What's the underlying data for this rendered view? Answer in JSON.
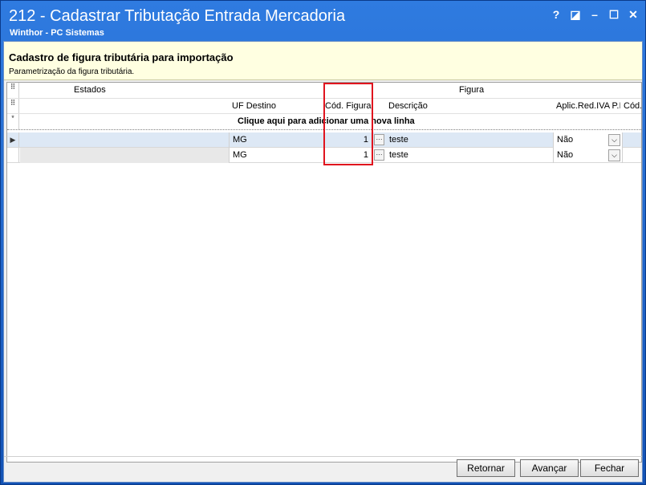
{
  "window": {
    "title": "212 - Cadastrar Tributação Entrada Mercadoria",
    "subtitle": "Winthor - PC Sistemas",
    "help": "?",
    "restore": "◪",
    "minimize": "–",
    "maximize": "☐",
    "close": "✕"
  },
  "header": {
    "title": "Cadastro de figura tributária para importação",
    "subtitle": "Parametrização da figura tributária."
  },
  "grid": {
    "bands": {
      "estados": "Estados",
      "figura": "Figura"
    },
    "columns": {
      "uf_destino": "UF Destino",
      "cod_figura": "Cód. Figura",
      "descricao": "Descrição",
      "aplic_red": "Aplic.Red.IVA P.I",
      "cod": "Cód."
    },
    "new_row_text": "Clique aqui para adicionar uma nova linha",
    "indicators": {
      "band": "⠿",
      "cols": "⠿",
      "new": "*",
      "current": "▶"
    },
    "ellipsis": "···",
    "combo_arrow": "⌵",
    "rows": [
      {
        "uf_destino": "MG",
        "cod_figura": "1",
        "descricao": "teste",
        "aplic_red": "Não"
      },
      {
        "uf_destino": "MG",
        "cod_figura": "1",
        "descricao": "teste",
        "aplic_red": "Não"
      }
    ]
  },
  "navigator": {
    "first": "⏮",
    "prev_page": "◀◀",
    "prev": "◀",
    "next": "▶",
    "next_page": "▶▶",
    "last": "⏭",
    "add": "+",
    "delete": "−",
    "up": "▲",
    "post": "✓",
    "cancel": "✗",
    "refresh": "↻",
    "star": "✱",
    "clear": "✲",
    "filter": "▼",
    "scroll_left": "<",
    "scroll_right": ">"
  },
  "buttons": {
    "retornar": "Retornar",
    "avancar": "Avançar",
    "fechar": "Fechar"
  }
}
